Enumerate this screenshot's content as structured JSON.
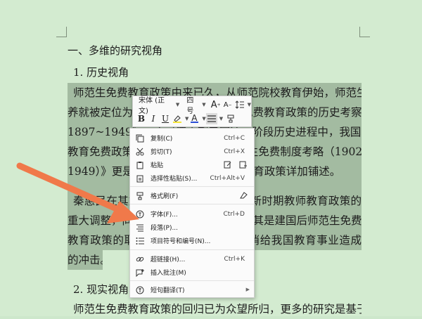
{
  "document": {
    "heading1": "一、多维的研究视角",
    "heading2": "1. 历史视角",
    "lines": [
      "师范生免费教育政策由来已久，从师范院校教育伊始，师范生的培",
      "养就被定位为免费教育。关于师范生免费教育政策的历史考察:",
      "1897~1949》一文对清末到民国这一阶段历史进程中，我国师范",
      "教育免费政策的演变进行梳理；《师范生免费制度考略（1902~",
      "1949）》更是对清末民国时期的免费教育政策详加铺述。",
      "秦惠民在其文章中提出了新的观点，新时期教师教育政策的",
      "重大调整，同时也留下了诸多问题，尤其是建国后师范生免费",
      "教育政策的取消。然而研究证实，取消给我国教育事业造成",
      "的冲击。"
    ],
    "heading3": "2. 现实视角",
    "last_line": "师范生免费教育政策的回归已为众望所归，更多的研究是基于这种"
  },
  "mini_toolbar": {
    "font_name": "宋体 (正文)",
    "font_size": "四号",
    "grow_font": "A",
    "shrink_font": "A",
    "bold": "B",
    "italic": "I",
    "underline": "U",
    "font_color_label": "A"
  },
  "context_menu": {
    "copy": {
      "label": "复制(C)",
      "shortcut": "Ctrl+C"
    },
    "cut": {
      "label": "剪切(T)",
      "shortcut": "Ctrl+X"
    },
    "paste": {
      "label": "粘贴"
    },
    "paste_special": {
      "label": "选择性粘贴(S)...",
      "shortcut": "Ctrl+Alt+V"
    },
    "format_painter": {
      "label": "格式刷(F)"
    },
    "font": {
      "label": "字体(F)...",
      "shortcut": "Ctrl+D"
    },
    "paragraph": {
      "label": "段落(P)..."
    },
    "bullets": {
      "label": "项目符号和编号(N)..."
    },
    "hyperlink": {
      "label": "超链接(H)...",
      "shortcut": "Ctrl+K"
    },
    "comment": {
      "label": "插入批注(M)"
    },
    "translate": {
      "label": "短句翻译(T)"
    }
  },
  "colors": {
    "page_bg": "#d3ebd0",
    "selection": "#a3bba1",
    "arrow": "#f0794a",
    "font_color_bar": "#2b4fd6",
    "highlight_bar": "#f5e535"
  }
}
